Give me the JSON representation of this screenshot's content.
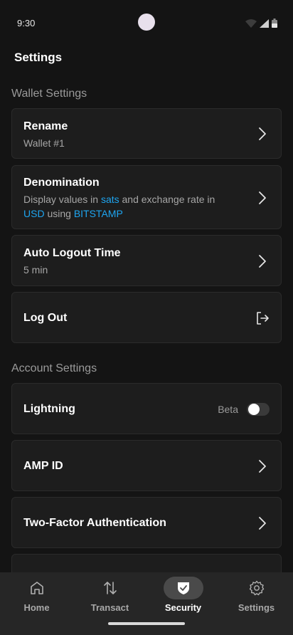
{
  "status": {
    "time": "9:30"
  },
  "page": {
    "title": "Settings"
  },
  "wallet_section": {
    "title": "Wallet Settings",
    "rename": {
      "title": "Rename",
      "subtitle": "Wallet #1"
    },
    "denomination": {
      "title": "Denomination",
      "line1_prefix": "Display values in ",
      "unit": "sats",
      "line1_suffix": " and exchange rate in",
      "currency": "USD",
      "line2_middle": " using ",
      "exchange": "BITSTAMP"
    },
    "auto_logout": {
      "title": "Auto Logout Time",
      "subtitle": "5 min"
    },
    "logout": {
      "title": "Log Out"
    }
  },
  "account_section": {
    "title": "Account Settings",
    "lightning": {
      "title": "Lightning",
      "badge": "Beta",
      "enabled": false
    },
    "amp_id": {
      "title": "AMP ID"
    },
    "two_factor": {
      "title": "Two-Factor Authentication"
    }
  },
  "bottom_nav": {
    "items": [
      {
        "label": "Home",
        "icon": "home-icon",
        "active": false
      },
      {
        "label": "Transact",
        "icon": "transfer-arrows-icon",
        "active": false
      },
      {
        "label": "Security",
        "icon": "shield-check-icon",
        "active": true
      },
      {
        "label": "Settings",
        "icon": "gear-icon",
        "active": false
      }
    ]
  },
  "colors": {
    "accent": "#1ea5f0",
    "background": "#141414",
    "card": "#1d1d1d",
    "nav": "#262626"
  }
}
